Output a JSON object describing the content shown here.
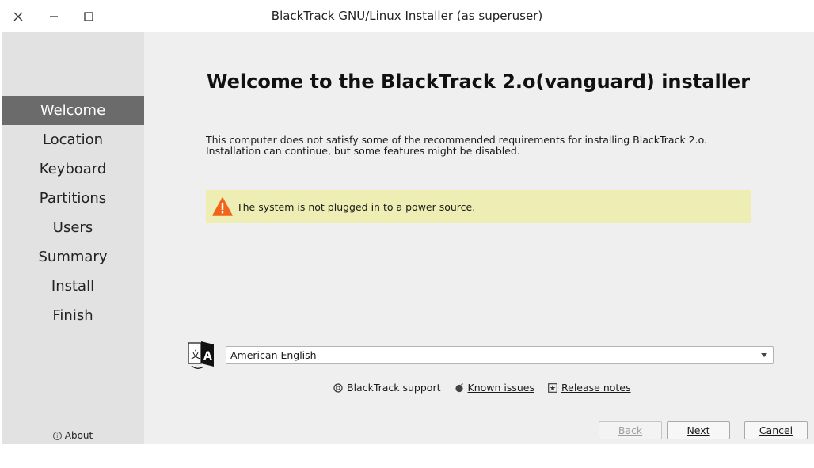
{
  "window": {
    "title": "BlackTrack GNU/Linux Installer (as superuser)"
  },
  "sidebar": {
    "items": [
      {
        "label": "Welcome",
        "active": true
      },
      {
        "label": "Location",
        "active": false
      },
      {
        "label": "Keyboard",
        "active": false
      },
      {
        "label": "Partitions",
        "active": false
      },
      {
        "label": "Users",
        "active": false
      },
      {
        "label": "Summary",
        "active": false
      },
      {
        "label": "Install",
        "active": false
      },
      {
        "label": "Finish",
        "active": false
      }
    ],
    "about_label": "About"
  },
  "main": {
    "heading": "Welcome to the BlackTrack 2.o(vanguard) installer",
    "requirements_line1": "This computer does not satisfy some of the recommended requirements for installing BlackTrack 2.o.",
    "requirements_line2": "Installation can continue, but some features might be disabled.",
    "warning_text": "The system is not plugged in to a power source.",
    "language_selected": "American English",
    "links": {
      "support": "BlackTrack support",
      "known_issues": "Known issues",
      "release_notes": "Release notes"
    }
  },
  "buttons": {
    "back": "Back",
    "next": "Next",
    "cancel": "Cancel"
  },
  "colors": {
    "sidebar_bg": "#e2e2e2",
    "sidebar_active": "#6b6b6b",
    "content_bg": "#efefef",
    "warning_bg": "#eeeeb4",
    "warning_icon": "#f0641e"
  },
  "icons": [
    "close-icon",
    "minimize-icon",
    "maximize-icon",
    "info-icon",
    "warning-icon",
    "language-icon",
    "support-icon",
    "known-issues-icon",
    "release-notes-icon",
    "chevron-down-icon"
  ]
}
